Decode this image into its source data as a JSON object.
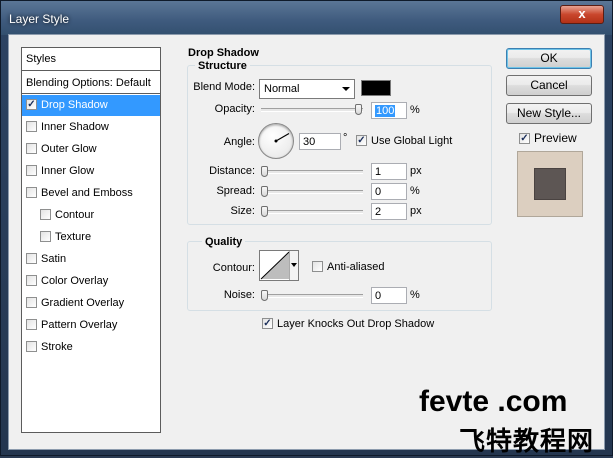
{
  "window": {
    "title": "Layer Style",
    "close_glyph": "x"
  },
  "left_panel": {
    "styles_label": "Styles",
    "blending_label": "Blending Options: Default",
    "items": [
      {
        "label": "Drop Shadow",
        "checked": true,
        "selected": true
      },
      {
        "label": "Inner Shadow",
        "checked": false
      },
      {
        "label": "Outer Glow",
        "checked": false
      },
      {
        "label": "Inner Glow",
        "checked": false
      },
      {
        "label": "Bevel and Emboss",
        "checked": false
      },
      {
        "label": "Contour",
        "checked": false,
        "indent": true
      },
      {
        "label": "Texture",
        "checked": false,
        "indent": true
      },
      {
        "label": "Satin",
        "checked": false
      },
      {
        "label": "Color Overlay",
        "checked": false
      },
      {
        "label": "Gradient Overlay",
        "checked": false
      },
      {
        "label": "Pattern Overlay",
        "checked": false
      },
      {
        "label": "Stroke",
        "checked": false
      }
    ]
  },
  "drop_shadow": {
    "title": "Drop Shadow",
    "structure": {
      "title": "Structure",
      "blend_mode_label": "Blend Mode:",
      "blend_mode_value": "Normal",
      "shadow_color": "#000000",
      "opacity_label": "Opacity:",
      "opacity_value": "100",
      "opacity_unit": "%",
      "angle_label": "Angle:",
      "angle_value": "30",
      "angle_unit": "°",
      "global_light_label": "Use Global Light",
      "global_light_checked": true,
      "distance_label": "Distance:",
      "distance_value": "1",
      "distance_unit": "px",
      "spread_label": "Spread:",
      "spread_value": "0",
      "spread_unit": "%",
      "size_label": "Size:",
      "size_value": "2",
      "size_unit": "px"
    },
    "quality": {
      "title": "Quality",
      "contour_label": "Contour:",
      "anti_aliased_label": "Anti-aliased",
      "anti_aliased_checked": false,
      "noise_label": "Noise:",
      "noise_value": "0",
      "noise_unit": "%"
    },
    "knocks_out_label": "Layer Knocks Out Drop Shadow",
    "knocks_out_checked": true
  },
  "buttons": {
    "ok": "OK",
    "cancel": "Cancel",
    "new_style": "New Style...",
    "preview_label": "Preview",
    "preview_checked": true
  },
  "preview_colors": {
    "background": "#dccfc0",
    "shape": "#5d5654"
  },
  "watermark": {
    "latin": "fevte .com",
    "chinese": "飞特教程网"
  }
}
